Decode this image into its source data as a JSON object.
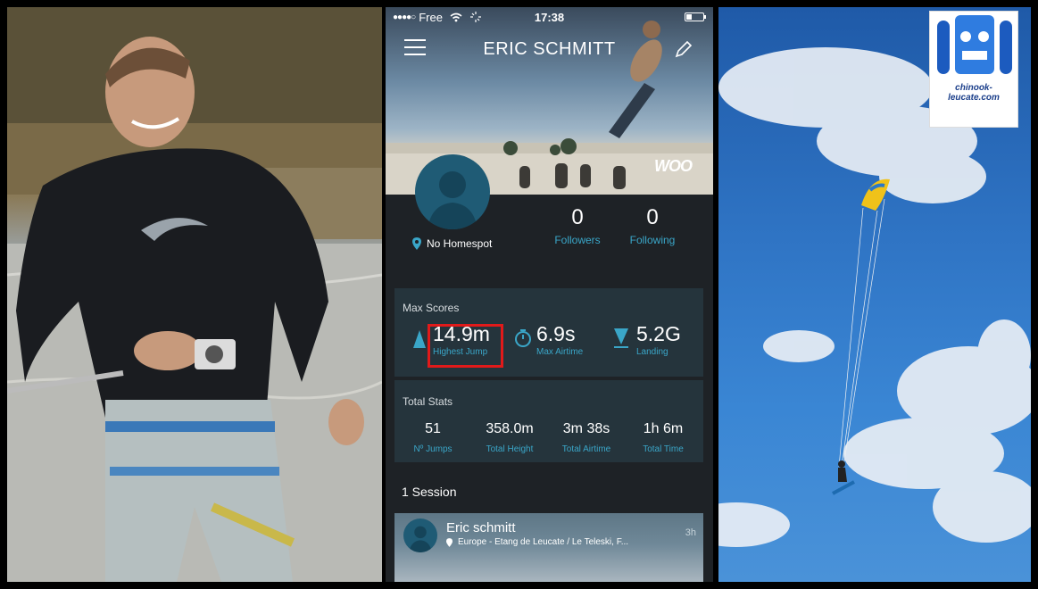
{
  "status_bar": {
    "signal": "●●●●○",
    "carrier": "Free",
    "time": "17:38"
  },
  "profile": {
    "name": "ERIC SCHMITT",
    "homespot": "No Homespot",
    "followers_count": "0",
    "followers_label": "Followers",
    "following_count": "0",
    "following_label": "Following"
  },
  "brand_logo": "WOO",
  "max_scores": {
    "title": "Max Scores",
    "items": [
      {
        "value": "14.9m",
        "label": "Highest Jump",
        "icon": "triangle-up-icon"
      },
      {
        "value": "6.9s",
        "label": "Max Airtime",
        "icon": "stopwatch-icon"
      },
      {
        "value": "5.2G",
        "label": "Landing",
        "icon": "triangle-down-icon"
      }
    ]
  },
  "total_stats": {
    "title": "Total Stats",
    "items": [
      {
        "value": "51",
        "label": "Nº Jumps"
      },
      {
        "value": "358.0m",
        "label": "Total Height"
      },
      {
        "value": "3m 38s",
        "label": "Total Airtime"
      },
      {
        "value": "1h 6m",
        "label": "Total Time"
      }
    ]
  },
  "sessions": {
    "heading": "1 Session",
    "items": [
      {
        "name": "Eric schmitt",
        "location": "Europe - Etang de Leucate / Le Teleski, F...",
        "age": "3h"
      }
    ]
  },
  "watermark": {
    "text": "chinook-leucate.com"
  },
  "colors": {
    "accent": "#3aa6c8",
    "highlight": "#e11a1a",
    "app_background": "#1e2226",
    "card": "#25343c"
  }
}
